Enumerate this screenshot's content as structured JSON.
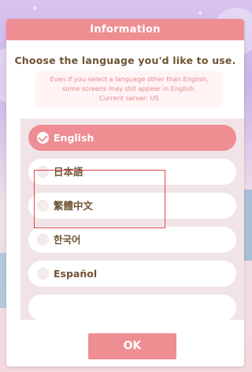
{
  "dialog": {
    "title": "Information",
    "prompt": "Choose the language you'd like to use.",
    "notice_lines": [
      "Even if you select a language other than English,",
      "some screens may still appear in English.",
      "Current server: US"
    ],
    "languages": [
      {
        "label": "English",
        "selected": true
      },
      {
        "label": "日本語",
        "selected": false
      },
      {
        "label": "繁體中文",
        "selected": false
      },
      {
        "label": "한국어",
        "selected": false
      },
      {
        "label": "Español",
        "selected": false
      }
    ],
    "ok_label": "OK"
  },
  "colors": {
    "accent": "#ee8d92",
    "text_brown": "#6f5434",
    "list_bg": "#f1e4e6",
    "highlight": "#e0474f"
  }
}
